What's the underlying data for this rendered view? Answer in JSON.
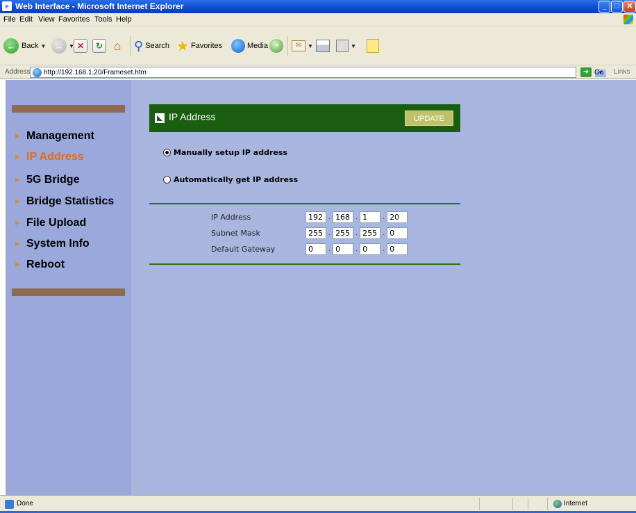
{
  "window": {
    "title": "Web Interface - Microsoft Internet Explorer"
  },
  "menubar": {
    "items": [
      "File",
      "Edit",
      "View",
      "Favorites",
      "Tools",
      "Help"
    ]
  },
  "toolbar": {
    "back_label": "Back",
    "search_label": "Search",
    "favorites_label": "Favorites",
    "media_label": "Media"
  },
  "addressbar": {
    "label": "Address",
    "url": "http://192.168.1.20/Frameset.htm",
    "go_label": "Go",
    "links_label": "Links"
  },
  "sidebar": {
    "items": [
      {
        "label": "Management",
        "active": false
      },
      {
        "label": "IP Address",
        "active": true
      },
      {
        "label": "5G Bridge",
        "active": false
      },
      {
        "label": "Bridge Statistics",
        "active": false
      },
      {
        "label": "File Upload",
        "active": false
      },
      {
        "label": "System Info",
        "active": false
      },
      {
        "label": "Reboot",
        "active": false
      }
    ]
  },
  "panel": {
    "title": "IP Address",
    "update_label": "UPDATE",
    "radio_manual": "Manually setup IP address",
    "radio_auto": "Automatically get IP address",
    "selected_mode": "manual",
    "fields": [
      {
        "label": "IP Address",
        "octets": [
          "192",
          "168",
          "1",
          "20"
        ]
      },
      {
        "label": "Subnet Mask",
        "octets": [
          "255",
          "255",
          "255",
          "0"
        ]
      },
      {
        "label": "Default Gateway",
        "octets": [
          "0",
          "0",
          "0",
          "0"
        ]
      }
    ],
    "octet_separator": "."
  },
  "statusbar": {
    "text": "Done",
    "zone": "Internet"
  },
  "colors": {
    "page_bg": "#a9b7e0",
    "sidebar_bg": "#9aa8dc",
    "header_green": "#1b5e12",
    "active_nav": "#e06b1e",
    "update_btn": "#bfc26a"
  }
}
